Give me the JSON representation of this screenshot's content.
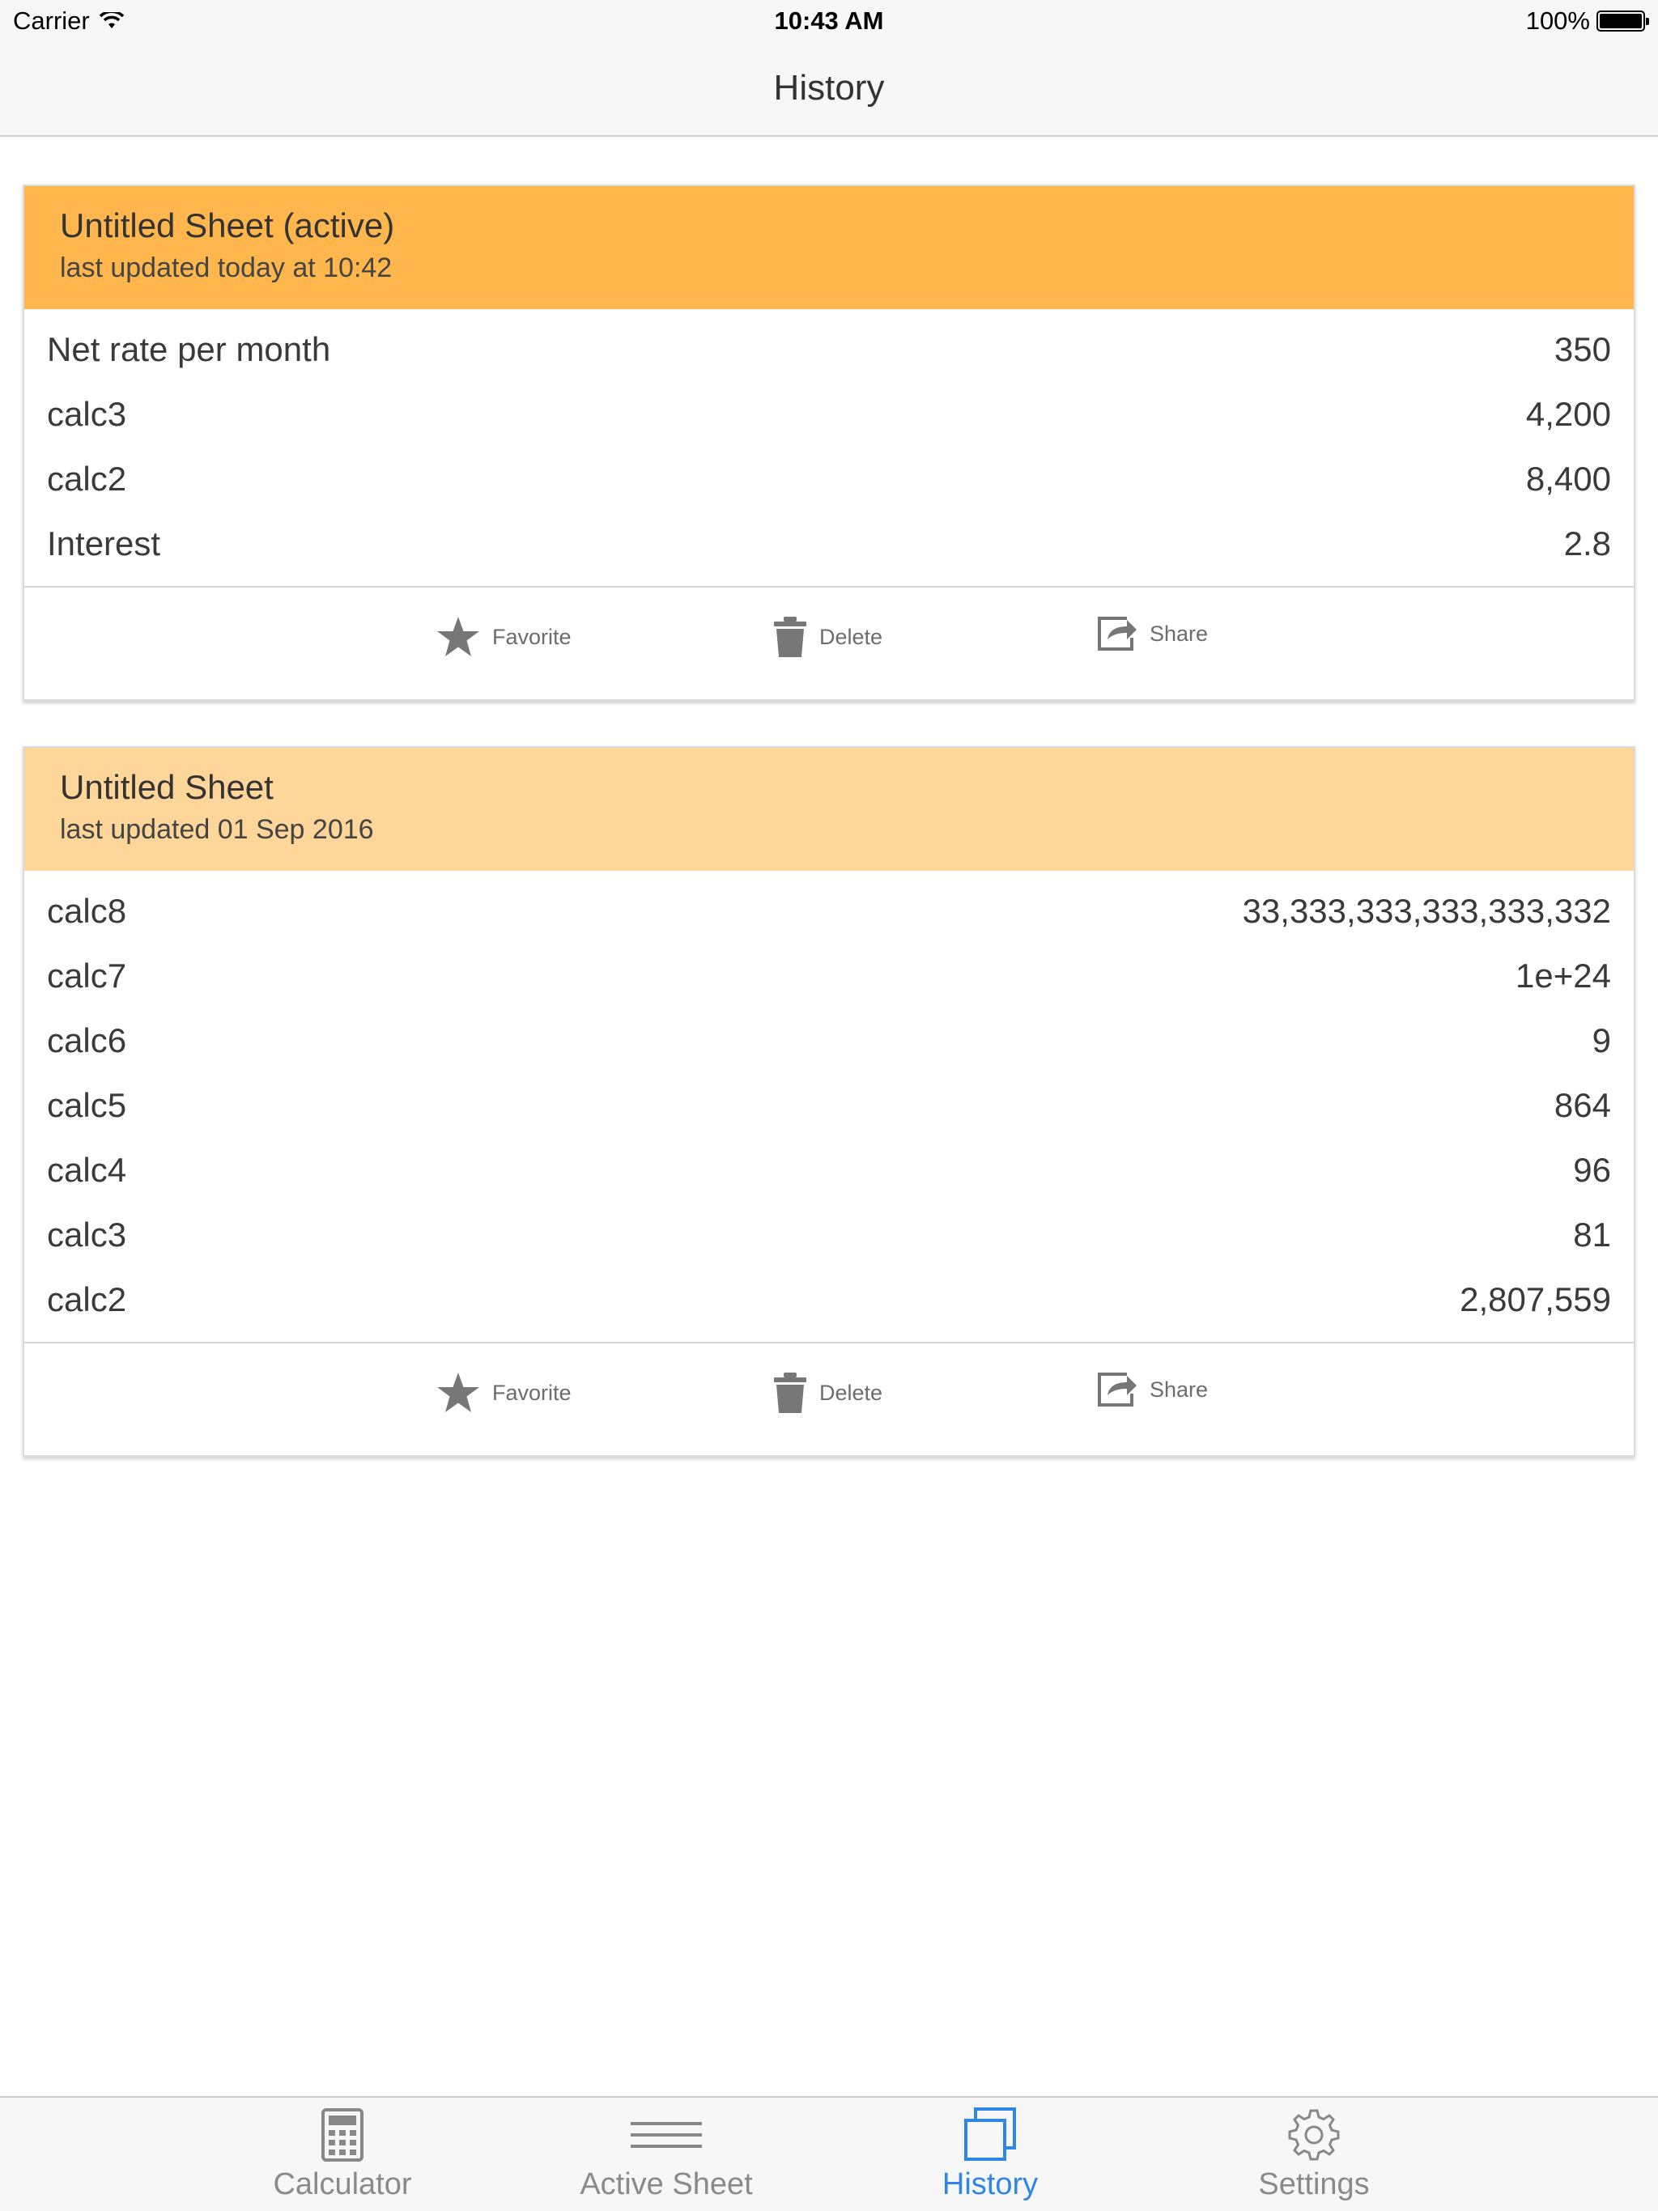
{
  "status_bar": {
    "carrier": "Carrier",
    "time": "10:43 AM",
    "battery": "100%"
  },
  "nav": {
    "title": "History"
  },
  "colors": {
    "active_header": "#ffb74d",
    "inactive_header": "#ffd699",
    "accent_tab": "#2f86e6",
    "icon_gray": "#7a7a7a"
  },
  "sheets": [
    {
      "title": "Untitled Sheet (active)",
      "subtitle": "last updated today at 10:42",
      "rows": [
        {
          "label": "Net rate per month",
          "value": "350"
        },
        {
          "label": "calc3",
          "value": "4,200"
        },
        {
          "label": "calc2",
          "value": "8,400"
        },
        {
          "label": "Interest",
          "value": "2.8"
        }
      ],
      "actions": {
        "favorite": "Favorite",
        "delete": "Delete",
        "share": "Share"
      }
    },
    {
      "title": "Untitled Sheet",
      "subtitle": "last updated 01 Sep 2016",
      "rows": [
        {
          "label": "calc8",
          "value": "33,333,333,333,333,332"
        },
        {
          "label": "calc7",
          "value": "1e+24"
        },
        {
          "label": "calc6",
          "value": "9"
        },
        {
          "label": "calc5",
          "value": "864"
        },
        {
          "label": "calc4",
          "value": "96"
        },
        {
          "label": "calc3",
          "value": "81"
        },
        {
          "label": "calc2",
          "value": "2,807,559"
        }
      ],
      "actions": {
        "favorite": "Favorite",
        "delete": "Delete",
        "share": "Share"
      }
    }
  ],
  "tabs": [
    {
      "label": "Calculator",
      "icon": "calculator-icon"
    },
    {
      "label": "Active Sheet",
      "icon": "lines-icon"
    },
    {
      "label": "History",
      "icon": "history-icon",
      "active": true
    },
    {
      "label": "Settings",
      "icon": "gear-icon"
    }
  ]
}
